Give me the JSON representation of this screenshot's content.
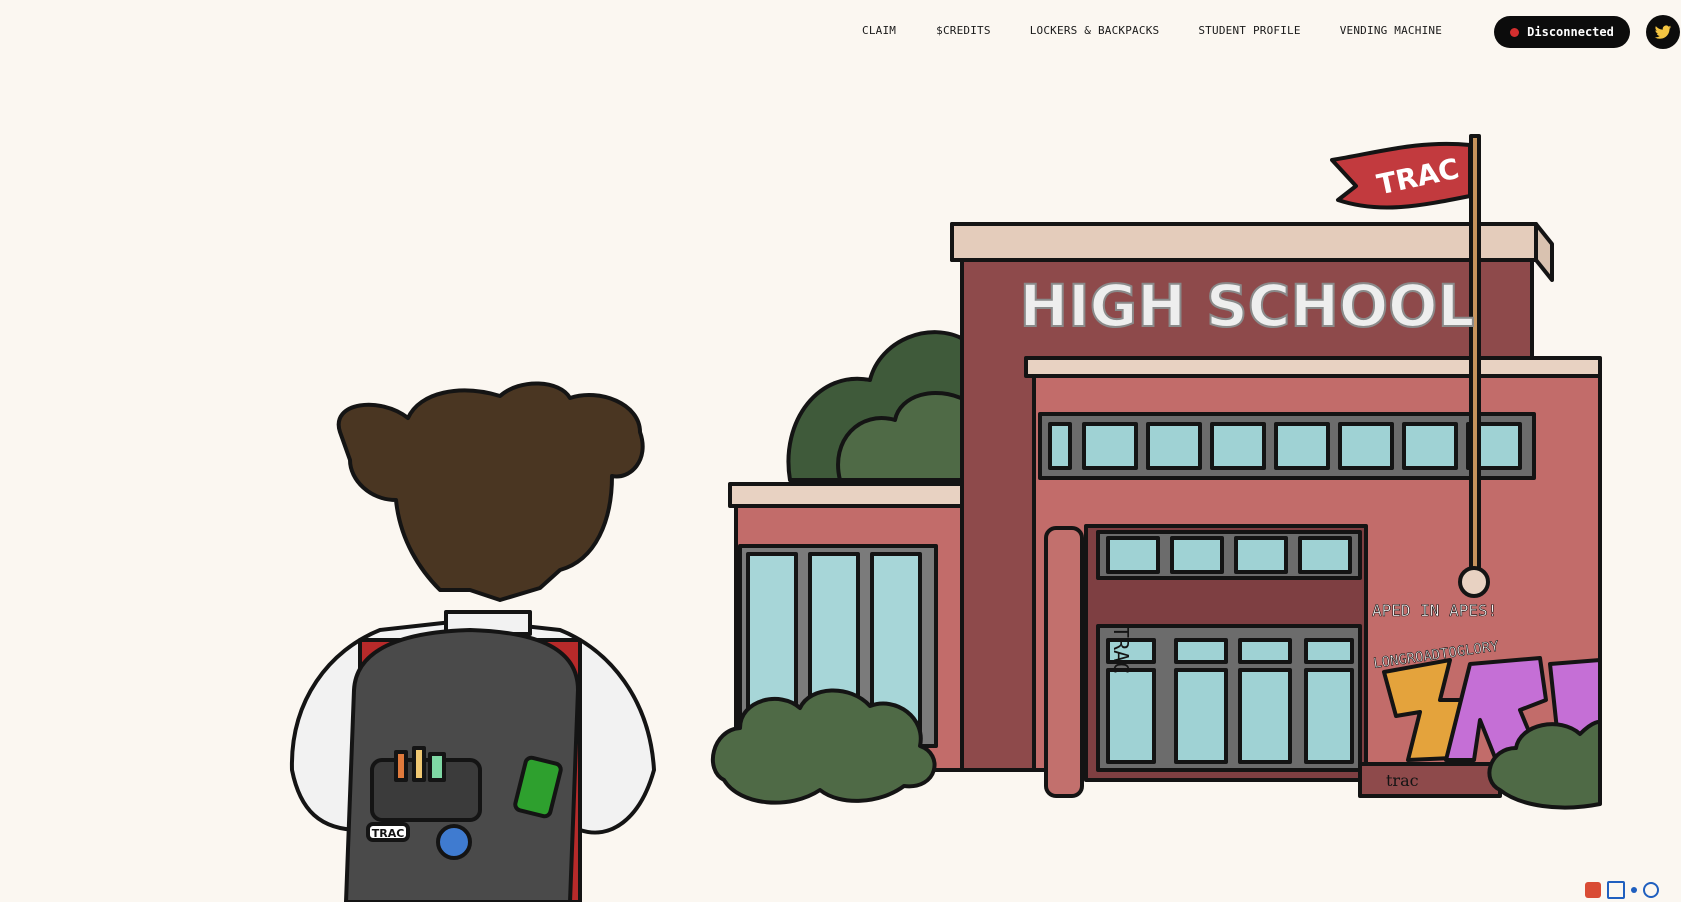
{
  "nav": {
    "links": [
      {
        "label": "CLAIM"
      },
      {
        "label": "$CREDITS"
      },
      {
        "label": "LOCKERS & BACKPACKS"
      },
      {
        "label": "STUDENT PROFILE"
      },
      {
        "label": "VENDING MACHINE"
      }
    ],
    "wallet_status": "Disconnected",
    "twitter_icon": "twitter-bird-icon"
  },
  "hero": {
    "sign": "HIGH SCHOOL",
    "flag": "TRAC",
    "pillar_text": "TRAC",
    "graffiti_tag": "APED IN APES!",
    "graffiti_line": "LONGROADTOGLORY",
    "graffiti_piece": "TRAC",
    "plaque": "trac",
    "patch": "TRAC"
  },
  "colors": {
    "background": "#fbf7f1",
    "brick": "#c26c6a",
    "brick_dark": "#8e4a4b",
    "glass": "#9fd2d4",
    "bush": "#4f6a46",
    "wallet_bg": "#0c0c0c",
    "status_dot": "#d32f2f"
  }
}
